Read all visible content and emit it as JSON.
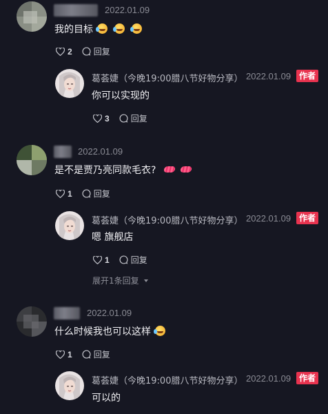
{
  "comments": [
    {
      "date": "2022.01.09",
      "text": "我的目标",
      "likes": "2",
      "reply_label": "回复",
      "reply": {
        "author": "葛荟婕（今晚19:00腊八节好物分享）",
        "date": "2022.01.09",
        "tag": "作者",
        "text": "你可以实现的",
        "likes": "3",
        "reply_label": "回复"
      }
    },
    {
      "date": "2022.01.09",
      "text": "是不是贾乃亮同款毛衣?",
      "likes": "1",
      "reply_label": "回复",
      "reply": {
        "author": "葛荟婕（今晚19:00腊八节好物分享）",
        "date": "2022.01.09",
        "tag": "作者",
        "text": "嗯 旗舰店",
        "likes": "1",
        "reply_label": "回复"
      },
      "expand_label": "展开1条回复"
    },
    {
      "date": "2022.01.09",
      "text": "什么时候我也可以这样",
      "likes": "1",
      "reply_label": "回复",
      "reply": {
        "author": "葛荟婕（今晚19:00腊八节好物分享）",
        "date": "2022.01.09",
        "tag": "作者",
        "text": "可以的"
      }
    }
  ],
  "icons": {
    "like": "heart-outline-icon",
    "reply": "speech-bubble-icon",
    "emoji_laugh": "laughing-tears-emoji",
    "emoji_lips": "lips-emoji",
    "expand": "caret-down-icon"
  },
  "colors": {
    "background": "#161722",
    "author_tag": "#e8334f"
  }
}
